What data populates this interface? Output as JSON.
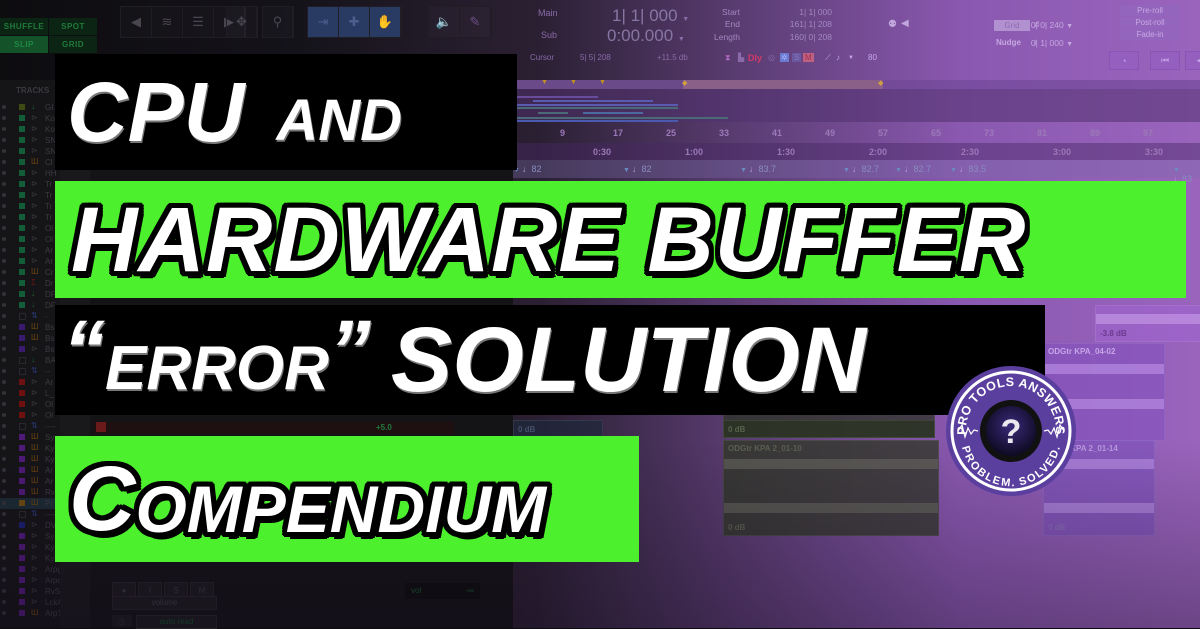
{
  "toolbar": {
    "edit_modes": [
      "SHUFFLE",
      "SPOT",
      "SLIP",
      "GRID"
    ],
    "active_mode": "SLIP",
    "counters": {
      "main_label": "Main",
      "main_value": "1| 1| 000",
      "sub_label": "Sub",
      "sub_value": "0:00.000"
    },
    "selection": {
      "start_label": "Start",
      "start_value": "1| 1| 000",
      "end_label": "End",
      "end_value": "161| 1| 208",
      "length_label": "Length",
      "length_value": "160| 0| 208"
    },
    "cursor": {
      "label": "Cursor",
      "value": "5| 5| 208",
      "level": "+11.5 db",
      "dly": "Dly",
      "solo": "S",
      "mute": "M",
      "tempo": "80"
    },
    "grid": {
      "grid_label": "Grid",
      "grid_value": "0| 0| 240",
      "nudge_label": "Nudge",
      "nudge_value": "0| 1| 000"
    },
    "roll": [
      "Pre-roll",
      "Post-roll",
      "Fade-in"
    ]
  },
  "ruler": {
    "bars": [
      "9",
      "17",
      "25",
      "33",
      "41",
      "49",
      "57",
      "65",
      "73",
      "81",
      "89",
      "97"
    ],
    "times": [
      "0:30",
      "1:00",
      "1:30",
      "2:00",
      "2:30",
      "3:00",
      "3:30"
    ],
    "tempos": [
      "82",
      "82",
      "83.7",
      "82.7",
      "82.7",
      "83.5",
      "83"
    ]
  },
  "tracks": {
    "header": "TRACKS",
    "items": [
      {
        "name": "GI",
        "color": "#3d4a12",
        "type": "down"
      },
      {
        "name": "Ko",
        "color": "#135e38",
        "type": "play"
      },
      {
        "name": "Ko",
        "color": "#135e38",
        "type": "play"
      },
      {
        "name": "SN",
        "color": "#135e38",
        "type": "play"
      },
      {
        "name": "SN",
        "color": "#135e38",
        "type": "play"
      },
      {
        "name": "Cl",
        "color": "#135e38",
        "type": "inst"
      },
      {
        "name": "HH",
        "color": "#135e38",
        "type": "play"
      },
      {
        "name": "Tr",
        "color": "#135e38",
        "type": "play"
      },
      {
        "name": "Tr",
        "color": "#135e38",
        "type": "play"
      },
      {
        "name": "Tr",
        "color": "#135e38",
        "type": "play"
      },
      {
        "name": "Tr",
        "color": "#135e38",
        "type": "play"
      },
      {
        "name": "Ol",
        "color": "#135e38",
        "type": "play"
      },
      {
        "name": "Ol",
        "color": "#135e38",
        "type": "play"
      },
      {
        "name": "Ar",
        "color": "#135e38",
        "type": "play"
      },
      {
        "name": "Ar",
        "color": "#135e38",
        "type": "play"
      },
      {
        "name": "Cr",
        "color": "#135e38",
        "type": "inst"
      },
      {
        "name": "Dr",
        "color": "#135e38",
        "type": "sum"
      },
      {
        "name": "DF",
        "color": "#135e38",
        "type": "down"
      },
      {
        "name": "DF",
        "color": "#135e38",
        "type": "down"
      },
      {
        "name": "-",
        "color": "",
        "type": "vca"
      },
      {
        "name": "Bs",
        "color": "#3a1a6e",
        "type": "inst"
      },
      {
        "name": "Bs",
        "color": "#3a1a6e",
        "type": "inst"
      },
      {
        "name": "Bs",
        "color": "#3a1a6e",
        "type": "play"
      },
      {
        "name": "BA",
        "color": "",
        "type": "down"
      },
      {
        "name": "--",
        "color": "",
        "type": "vca"
      },
      {
        "name": "Ar",
        "color": "#6e1010",
        "type": "play"
      },
      {
        "name": "L_",
        "color": "#6e1010",
        "type": "play"
      },
      {
        "name": "Ol",
        "color": "#6e1010",
        "type": "play"
      },
      {
        "name": "Ol",
        "color": "#6e1010",
        "type": "play"
      },
      {
        "name": "----",
        "color": "",
        "type": "vca"
      },
      {
        "name": "Sy",
        "color": "#4e1a78",
        "type": "inst"
      },
      {
        "name": "Ky",
        "color": "#4e1a78",
        "type": "inst"
      },
      {
        "name": "Ky",
        "color": "#4e1a78",
        "type": "inst"
      },
      {
        "name": "Ar",
        "color": "#4e1a78",
        "type": "inst"
      },
      {
        "name": "Ar",
        "color": "#4e1a78",
        "type": "inst"
      },
      {
        "name": "Rv",
        "color": "#4e1a78",
        "type": "inst"
      },
      {
        "name": "Pi",
        "color": "#6e4a10",
        "type": "inst",
        "selected": true
      },
      {
        "name": "----",
        "color": "",
        "type": "vca"
      },
      {
        "name": "DV",
        "color": "#1a1e70",
        "type": "play"
      },
      {
        "name": "Sy",
        "color": "#4e1a78",
        "type": "play"
      },
      {
        "name": "Ky",
        "color": "#4e1a78",
        "type": "play"
      },
      {
        "name": "Kys2",
        "color": "#4e1a78",
        "type": "play"
      },
      {
        "name": "Arpg",
        "color": "#4e1a78",
        "type": "play"
      },
      {
        "name": "Arpc",
        "color": "#4e1a78",
        "type": "play"
      },
      {
        "name": "RvSy",
        "color": "#4e1a78",
        "type": "play"
      },
      {
        "name": "LckA",
        "color": "#4e1a78",
        "type": "play"
      },
      {
        "name": "ArpT",
        "color": "#4e1a78",
        "type": "inst"
      }
    ]
  },
  "mixer": {
    "fader_level": "+5.0",
    "buttons": [
      "●",
      "I",
      "S",
      "M"
    ],
    "automation_target": "volume",
    "automation_mode": "auto read",
    "vol_label": "vol",
    "vol_value": "-∞"
  },
  "clips": [
    {
      "name": "",
      "gain": "-3.8 dB"
    },
    {
      "name": "ODGtr KPA_04-02",
      "gain": ""
    },
    {
      "name": "",
      "gain": "0 dB"
    },
    {
      "name": "",
      "gain": "0 dB"
    },
    {
      "name": "",
      "gain": "0 dB"
    },
    {
      "name": "ODGtr KPA 2_01-10",
      "gain": "0 dB"
    },
    {
      "name": "ODGtr KPA 2_01-14",
      "gain": "0 dB"
    }
  ],
  "title": {
    "line1_a": "CPU",
    "line1_b": "AND",
    "line2": "HARDWARE BUFFER",
    "line3_open": "“",
    "line3_word": "ERROR",
    "line3_close": "”",
    "line3_b": "SOLUTION",
    "line4_first": "C",
    "line4_rest": "OMPENDIUM"
  },
  "badge": {
    "top_text": "PRO TOOLS ANSWERS",
    "bottom_text": "PROBLEM. SOLVED.",
    "center_glyph": "?"
  },
  "colors": {
    "banner_green": "#4cf02d",
    "banner_black": "#000000",
    "badge_purple": "#5b3fa0"
  }
}
